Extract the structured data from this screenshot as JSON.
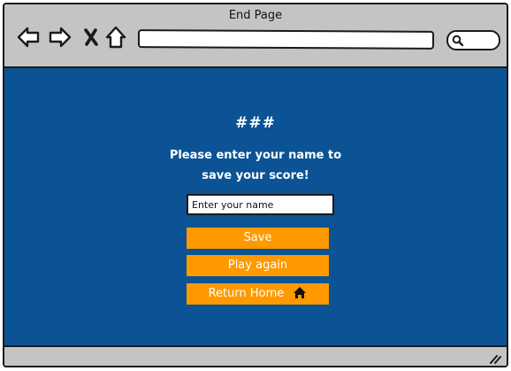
{
  "window": {
    "title": "End Page"
  },
  "toolbar": {
    "icons": [
      "back-arrow-icon",
      "forward-arrow-icon",
      "close-x-icon",
      "home-icon"
    ],
    "url_value": "",
    "search_value": ""
  },
  "end_page": {
    "score_text": "###",
    "prompt_text": "Please enter your name to save your score!",
    "name_input": {
      "placeholder": "Enter your name",
      "value": ""
    },
    "buttons": {
      "save_label": "Save",
      "play_again_label": "Play again",
      "return_home_label": "Return Home"
    }
  },
  "colors": {
    "content_background": "#0b5394",
    "button_background": "#ff9900",
    "chrome_background": "#c4c4c4",
    "text_on_content": "#ffffff"
  }
}
